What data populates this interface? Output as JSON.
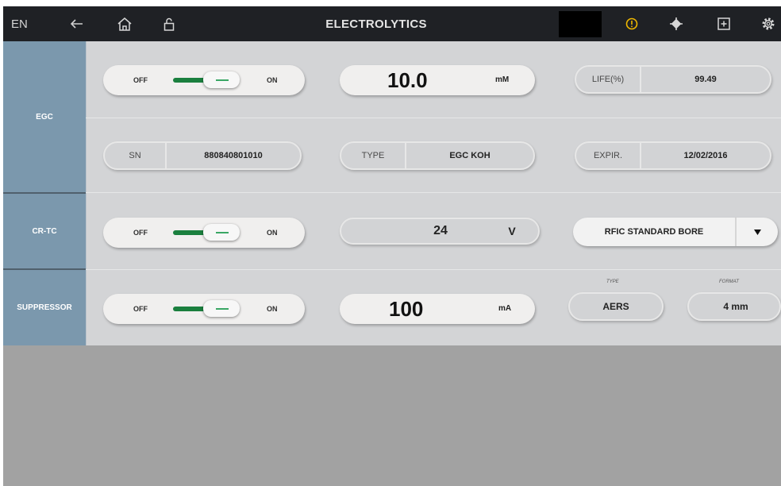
{
  "topbar": {
    "lang": "EN",
    "title": "ELECTROLYTICS",
    "warning_color": "#f0b800",
    "icons": [
      "back-arrow-icon",
      "home-icon",
      "unlock-icon",
      "warning-icon",
      "locate-icon",
      "add-box-icon",
      "gear-icon"
    ]
  },
  "sections": {
    "egc": {
      "label": "EGC",
      "toggle": {
        "off": "OFF",
        "on": "ON",
        "state": "on"
      },
      "concentration": {
        "value": "10.0",
        "unit": "mM"
      },
      "life": {
        "label": "LIFE(%)",
        "value": "99.49"
      },
      "sn": {
        "label": "SN",
        "value": "880840801010"
      },
      "type": {
        "label": "TYPE",
        "value": "EGC KOH"
      },
      "expir": {
        "label": "EXPIR.",
        "value": "12/02/2016"
      }
    },
    "crtc": {
      "label": "CR-TC",
      "toggle": {
        "off": "OFF",
        "on": "ON",
        "state": "on"
      },
      "voltage": {
        "value": "24",
        "unit": "V"
      },
      "mode": {
        "value": "RFIC STANDARD BORE"
      }
    },
    "suppressor": {
      "label": "SUPPRESSOR",
      "toggle": {
        "off": "OFF",
        "on": "ON",
        "state": "on"
      },
      "current": {
        "value": "100",
        "unit": "mA"
      },
      "type": {
        "label": "TYPE",
        "value": "AERS"
      },
      "format": {
        "label": "FORMAT",
        "value": "4 mm"
      }
    }
  },
  "colors": {
    "toggle_on": "#1a7f3e",
    "sidebar": "#7b98ad",
    "topbar": "#1f2125"
  }
}
